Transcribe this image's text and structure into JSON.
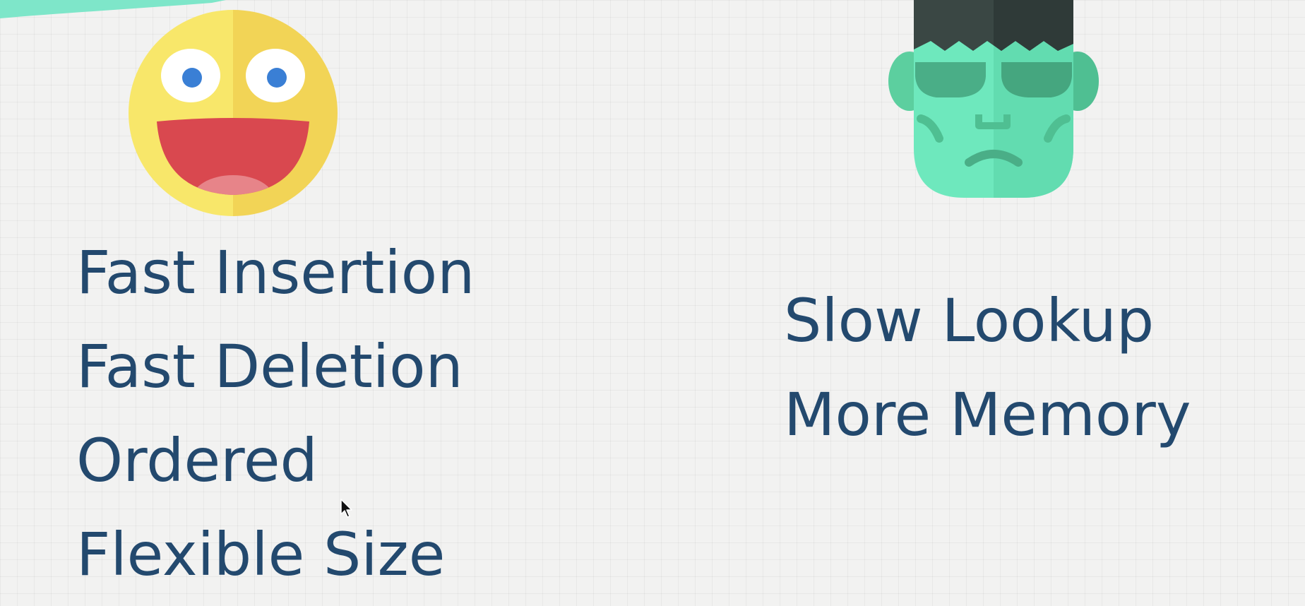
{
  "pros": {
    "icon": "happy-face-icon",
    "items": [
      "Fast Insertion",
      "Fast Deletion",
      "Ordered",
      "Flexible Size"
    ]
  },
  "cons": {
    "icon": "frankenstein-monster-icon",
    "items": [
      "Slow Lookup",
      "More Memory"
    ]
  },
  "colors": {
    "text": "#23496e",
    "background": "#f2f2f1",
    "face_yellow": "#f7df5e",
    "mouth_red": "#d9484f",
    "monster_green": "#6ee8bd",
    "monster_hair": "#2f3a38",
    "accent_teal": "#7ee6c9"
  }
}
